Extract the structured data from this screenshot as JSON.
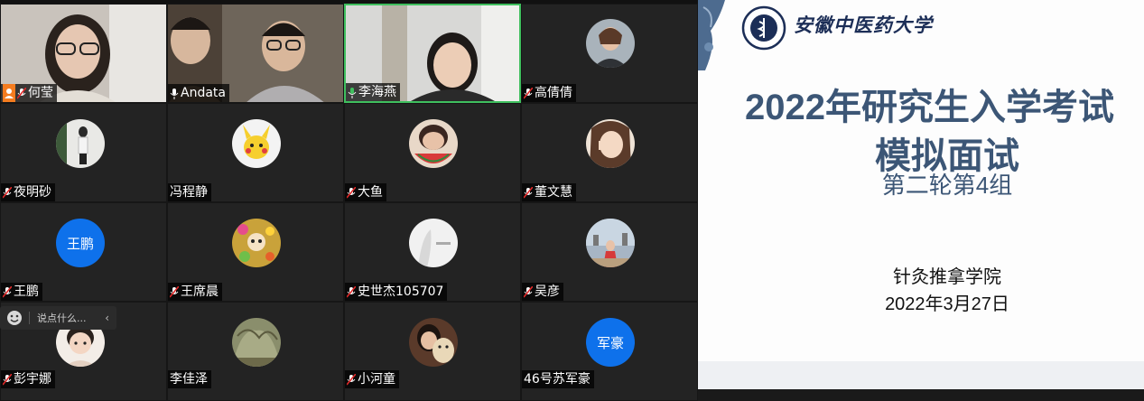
{
  "participants": [
    {
      "name": "何莹",
      "type": "video",
      "host": true,
      "mic": "muted"
    },
    {
      "name": "Andata",
      "type": "video",
      "mic": "on"
    },
    {
      "name": "李海燕",
      "type": "video",
      "mic": "speaking",
      "active": true
    },
    {
      "name": "高倩倩",
      "type": "avatar",
      "mic": "muted"
    },
    {
      "name": "夜明砂",
      "type": "avatar",
      "mic": "muted"
    },
    {
      "name": "冯程静",
      "type": "avatar",
      "mic": "none"
    },
    {
      "name": "大鱼",
      "type": "avatar",
      "mic": "muted"
    },
    {
      "name": "董文慧",
      "type": "avatar",
      "mic": "muted"
    },
    {
      "name": "王鹏",
      "type": "initials",
      "initials": "王鹏",
      "mic": "muted"
    },
    {
      "name": "王席晨",
      "type": "avatar",
      "mic": "muted"
    },
    {
      "name": "史世杰105707",
      "type": "avatar",
      "mic": "muted"
    },
    {
      "name": "吴彦",
      "type": "avatar",
      "mic": "muted"
    },
    {
      "name": "彭宇娜",
      "type": "avatar",
      "mic": "muted"
    },
    {
      "name": "李佳泽",
      "type": "avatar",
      "mic": "none"
    },
    {
      "name": "小河童",
      "type": "avatar",
      "mic": "muted"
    },
    {
      "name": "46号苏军豪",
      "type": "initials",
      "initials": "军豪",
      "mic": "none"
    }
  ],
  "chat": {
    "placeholder": "说点什么...",
    "collapse_icon": "chevron-left-icon"
  },
  "slide": {
    "university": "安徽中医药大学",
    "title_line1": "2022年研究生入学考试",
    "title_line2": "模拟面试",
    "subtitle": "第二轮第4组",
    "college": "针灸推拿学院",
    "date": "2022年3月27日"
  },
  "colors": {
    "accent": "#0e71eb",
    "active_border": "#3fbf5e",
    "mic_muted": "#e02828",
    "slide_title": "#3c5676",
    "host_badge": "#f57c1f"
  }
}
